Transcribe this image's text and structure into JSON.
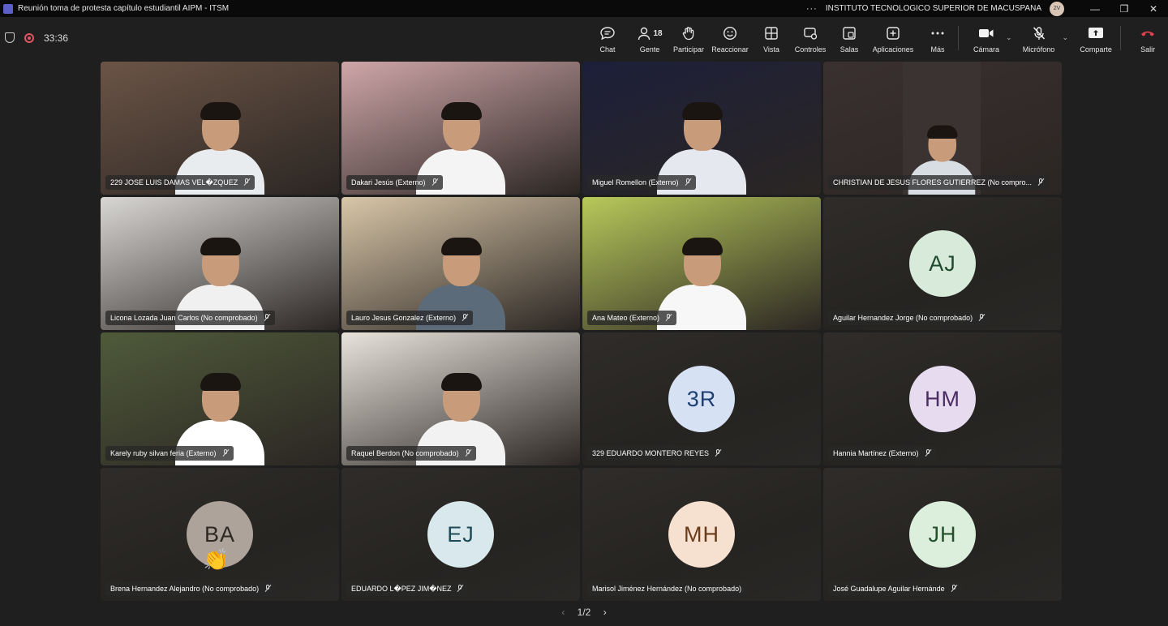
{
  "window": {
    "title": "Reunión toma de protesta capítulo estudiantil AIPM - ITSM",
    "more": "···",
    "organization": "INSTITUTO TECNOLOGICO SUPERIOR DE MACUSPANA",
    "user_initials": "2V",
    "minimize": "—",
    "restore": "❐",
    "close": "✕"
  },
  "meeting": {
    "timer": "33:36",
    "tools": {
      "chat": "Chat",
      "people": "Gente",
      "people_count": "18",
      "raise": "Participar",
      "react": "Reaccionar",
      "view": "Vista",
      "controls": "Controles",
      "rooms": "Salas",
      "apps": "Aplicaciones",
      "more": "Más",
      "camera": "Cámara",
      "mic": "Micrófono",
      "share": "Comparte",
      "leave": "Salir"
    }
  },
  "participants": [
    {
      "name": "229 JOSE LUIS DAMAS VEL�ZQUEZ",
      "video": true,
      "scene": "#6b5446",
      "shirt": "#e9ecef"
    },
    {
      "name": "Dakari Jesús (Externo)",
      "video": true,
      "scene": "#cfa6a8",
      "shirt": "#f4f4f4"
    },
    {
      "name": "Miguel Romellon (Externo)",
      "video": true,
      "scene": "#1c1f3a",
      "shirt": "#e6e8f0"
    },
    {
      "name": "CHRISTIAN DE JESUS FLORES GUTIERREZ (No compro...",
      "video": true,
      "scene": "#3a3030",
      "shirt": "#d8dde3",
      "narrow": true
    },
    {
      "name": "Licona Lozada Juan Carlos (No comprobado)",
      "video": true,
      "scene": "#d9d7d4",
      "shirt": "#f0f0f0"
    },
    {
      "name": "Lauro Jesus Gonzalez (Externo)",
      "video": true,
      "scene": "#d8c6a8",
      "shirt": "#5c6b7a"
    },
    {
      "name": "Ana Mateo (Externo)",
      "video": true,
      "scene": "#b8c95a",
      "shirt": "#f7f7f7"
    },
    {
      "name": "Aguilar Hernandez Jorge (No comprobado)",
      "video": false,
      "initials": "AJ",
      "avatar_bg": "#d8ead9",
      "avatar_fg": "#1f4a2e"
    },
    {
      "name": "Karely ruby silvan feria (Externo)",
      "video": true,
      "scene": "#4f5a3a",
      "shirt": "#ffffff"
    },
    {
      "name": "Raquel Berdon (No comprobado)",
      "video": true,
      "scene": "#e8e4dc",
      "shirt": "#f2f2f2"
    },
    {
      "name": "329 EDUARDO MONTERO REYES",
      "video": false,
      "initials": "3R",
      "avatar_bg": "#d6e1f3",
      "avatar_fg": "#1d3f73"
    },
    {
      "name": "Hannia Martínez (Externo)",
      "video": false,
      "initials": "HM",
      "avatar_bg": "#e7dcef",
      "avatar_fg": "#4b2d63"
    },
    {
      "name": "Brena Hernandez Alejandro (No comprobado)",
      "video": false,
      "initials": "BA",
      "avatar_bg": "#ada39b",
      "avatar_fg": "#2e2823",
      "reaction": "👏"
    },
    {
      "name": "EDUARDO L�PEZ JIM�NEZ",
      "video": false,
      "initials": "EJ",
      "avatar_bg": "#d9e8ec",
      "avatar_fg": "#1e4a55"
    },
    {
      "name": "Marisol Jiménez Hernández (No comprobado)",
      "video": false,
      "initials": "MH",
      "avatar_bg": "#f6e0cf",
      "avatar_fg": "#6a3b1a",
      "unmuted": true
    },
    {
      "name": "José Guadalupe Aguilar Hernánde",
      "video": false,
      "initials": "JH",
      "avatar_bg": "#dceedc",
      "avatar_fg": "#22502a"
    }
  ],
  "pager": {
    "label": "1/2",
    "prev": "‹",
    "next": "›"
  }
}
